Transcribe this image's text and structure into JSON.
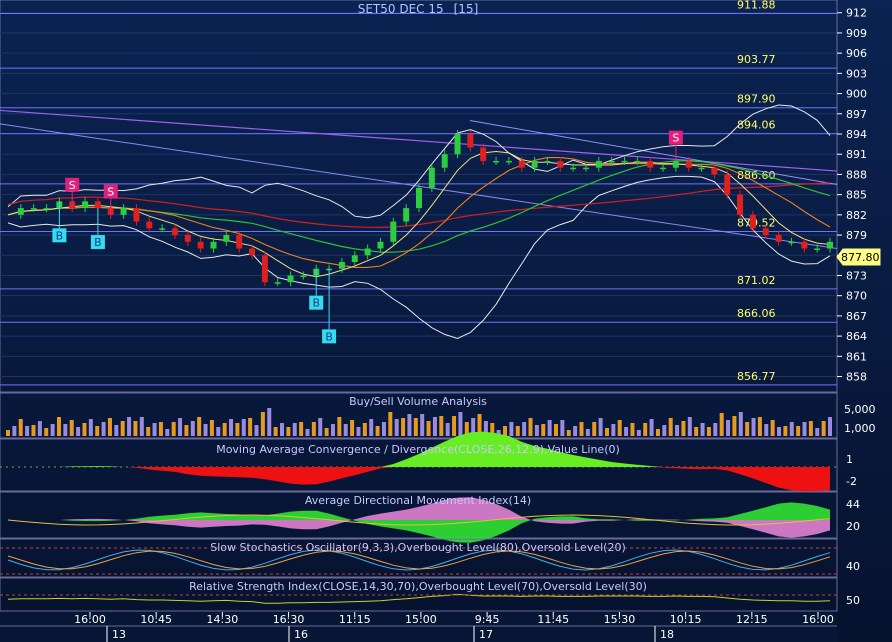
{
  "chart_data": {
    "type": "line",
    "title": "SET50 DEC 15",
    "interval_label": "[15]",
    "current_price": "877.80",
    "price_axis": {
      "ylim": [
        856,
        913
      ],
      "ticks": [
        "912",
        "909",
        "906",
        "903",
        "900",
        "897",
        "894",
        "891",
        "888",
        "885",
        "882",
        "879",
        "876",
        "873",
        "870",
        "867",
        "864",
        "861",
        "858"
      ]
    },
    "horizontal_levels": [
      "911.88",
      "903.77",
      "897.90",
      "894.06",
      "886.60",
      "879.52",
      "871.02",
      "866.06",
      "856.77"
    ],
    "time_axis": {
      "labels": [
        "16:00",
        "10:45",
        "14:30",
        "16:30",
        "11:15",
        "15:00",
        "9:45",
        "11:45",
        "15:30",
        "10:15",
        "12:15",
        "16:00"
      ],
      "days": [
        "13",
        "16",
        "17",
        "18"
      ]
    },
    "signals": {
      "buy_label": "B",
      "sell_label": "S",
      "buy_count": 4,
      "sell_count": 3
    },
    "colors": {
      "background_top": "#0b1f4a",
      "background_bottom": "#061230",
      "up_candle": "#2ecc40",
      "down_candle": "#e0201e",
      "level_line": "#6b76ff",
      "level_label": "#ffff66",
      "buy_marker": "#33ddee",
      "sell_marker": "#e0207a",
      "axis_text": "#ffffff",
      "panel_title": "#c8c8ff"
    },
    "series": [
      {
        "values": [
          882,
          883,
          883,
          883,
          884,
          883,
          884,
          883,
          882,
          883,
          881,
          880,
          880,
          879,
          878,
          877,
          878,
          879,
          877,
          876,
          872,
          872,
          873,
          873,
          874,
          874,
          875,
          876,
          877,
          878,
          881,
          883,
          886,
          889,
          891,
          894,
          892,
          890,
          890,
          890,
          889,
          890,
          890,
          889,
          889,
          889,
          890,
          890,
          890,
          890,
          889,
          889,
          890,
          889,
          889,
          888,
          885,
          882,
          880,
          879,
          878,
          878,
          877,
          877,
          878
        ]
      }
    ],
    "panels": [
      {
        "title": "Buy/Sell Volume Analysis",
        "ticks": [
          "5,000",
          "1,000"
        ]
      },
      {
        "title": "Moving Average Convergence / Divergence(CLOSE,26,12,9),Value Line(0)",
        "ticks": [
          "1",
          "-2"
        ]
      },
      {
        "title": "Average Directional Movement Index(14)",
        "ticks": [
          "44",
          "20"
        ]
      },
      {
        "title": "Slow Stochastics Oscillator(9,3,3),Overbought Level(80),Oversold Level(20)",
        "ticks": [
          "40"
        ]
      },
      {
        "title": "Relative Strength Index(CLOSE,14,30,70),Overbought Level(70),Oversold Level(30)",
        "ticks": [
          "50"
        ]
      }
    ]
  }
}
